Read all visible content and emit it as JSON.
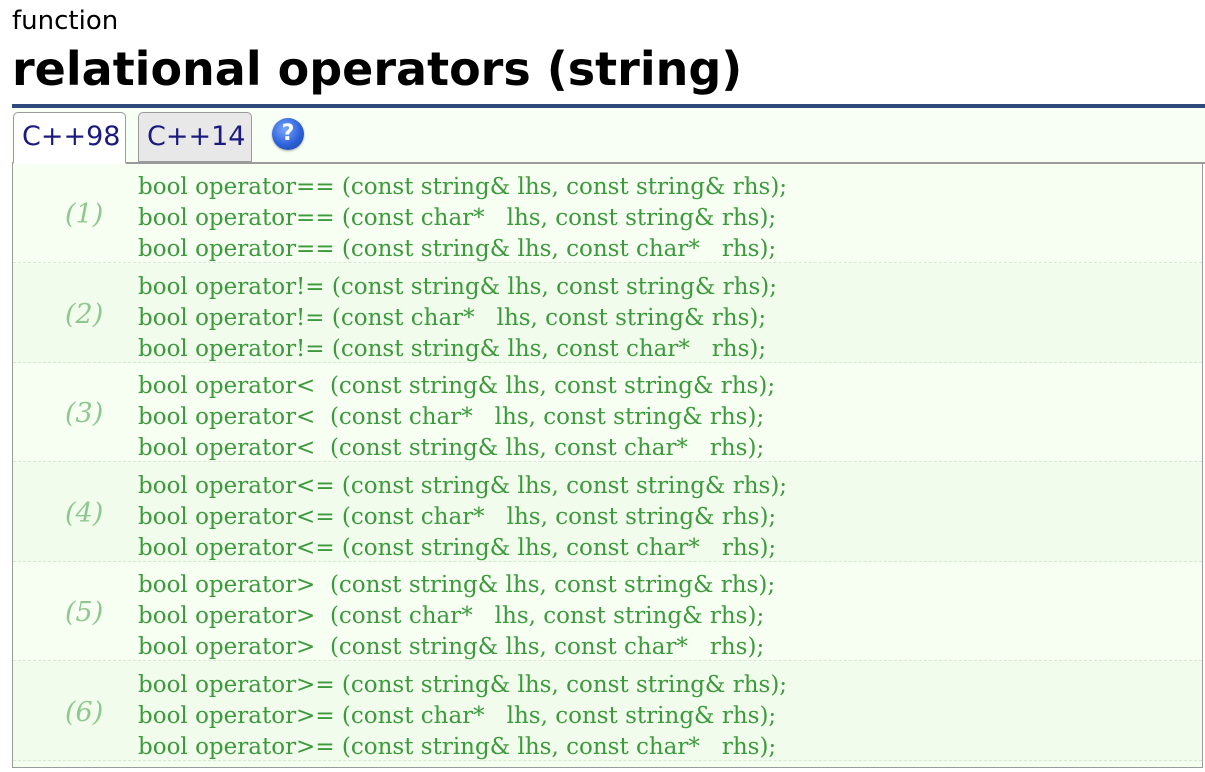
{
  "header": {
    "kind": "function",
    "title": "relational operators (string)"
  },
  "tabs": [
    {
      "label": "C++98",
      "active": true
    },
    {
      "label": "C++14",
      "active": false
    }
  ],
  "help_icon": {
    "symbol": "?",
    "icon": "help-icon"
  },
  "colors": {
    "rule": "#2e4a7d",
    "code": "#3c9a3c",
    "number": "#8fc88f",
    "tab_text": "#1a1a80",
    "panel_bg": "#f5fff0"
  },
  "groups": [
    {
      "number": "(1)",
      "lines": [
        "bool operator== (const string& lhs, const string& rhs);",
        "bool operator== (const char*   lhs, const string& rhs);",
        "bool operator== (const string& lhs, const char*   rhs);"
      ]
    },
    {
      "number": "(2)",
      "lines": [
        "bool operator!= (const string& lhs, const string& rhs);",
        "bool operator!= (const char*   lhs, const string& rhs);",
        "bool operator!= (const string& lhs, const char*   rhs);"
      ]
    },
    {
      "number": "(3)",
      "lines": [
        "bool operator<  (const string& lhs, const string& rhs);",
        "bool operator<  (const char*   lhs, const string& rhs);",
        "bool operator<  (const string& lhs, const char*   rhs);"
      ]
    },
    {
      "number": "(4)",
      "lines": [
        "bool operator<= (const string& lhs, const string& rhs);",
        "bool operator<= (const char*   lhs, const string& rhs);",
        "bool operator<= (const string& lhs, const char*   rhs);"
      ]
    },
    {
      "number": "(5)",
      "lines": [
        "bool operator>  (const string& lhs, const string& rhs);",
        "bool operator>  (const char*   lhs, const string& rhs);",
        "bool operator>  (const string& lhs, const char*   rhs);"
      ]
    },
    {
      "number": "(6)",
      "lines": [
        "bool operator>= (const string& lhs, const string& rhs);",
        "bool operator>= (const char*   lhs, const string& rhs);",
        "bool operator>= (const string& lhs, const char*   rhs);"
      ]
    }
  ]
}
